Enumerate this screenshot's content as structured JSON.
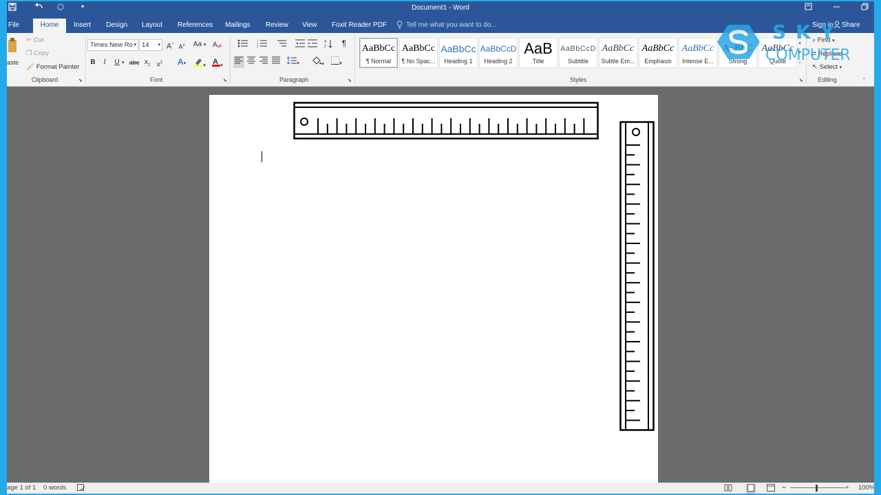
{
  "window": {
    "title": "Document1 - Word",
    "qat_icons": [
      "save-icon",
      "undo-icon",
      "redo-icon",
      "customize-icon"
    ],
    "controls": [
      "ribbon-display-icon",
      "minimize-icon",
      "restore-icon"
    ]
  },
  "tabs": [
    "File",
    "Home",
    "Insert",
    "Design",
    "Layout",
    "References",
    "Mailings",
    "Review",
    "View",
    "Foxit Reader PDF"
  ],
  "active_tab": "Home",
  "tell_me": "Tell me what you want to do...",
  "account": {
    "sign_in": "Sign in",
    "share": "Share"
  },
  "clipboard": {
    "paste": "aste",
    "cut": "Cut",
    "copy": "Copy",
    "format_painter": "Format Painter",
    "label": "Clipboard"
  },
  "font": {
    "name": "Times New Ro",
    "size": "14",
    "grow": "A",
    "shrink": "A",
    "case": "Aa",
    "bold": "B",
    "italic": "I",
    "underline": "U",
    "strike": "abc",
    "subscript": "x",
    "superscript": "x",
    "label": "Font",
    "highlight_color": "#ffff00",
    "font_color": "#e81123"
  },
  "paragraph": {
    "pilcrow": "¶",
    "label": "Paragraph"
  },
  "styles": {
    "label": "Styles",
    "items": [
      {
        "sample": "AaBbCc",
        "name": "¶ Normal"
      },
      {
        "sample": "AaBbCc",
        "name": "¶ No Spac..."
      },
      {
        "sample": "AaBbCc",
        "name": "Heading 1"
      },
      {
        "sample": "AaBbCcD",
        "name": "Heading 2"
      },
      {
        "sample": "AaB",
        "name": "Title"
      },
      {
        "sample": "AaBbCcD",
        "name": "Subtitle"
      },
      {
        "sample": "AaBbCc",
        "name": "Subtle Em..."
      },
      {
        "sample": "AaBbCc",
        "name": "Emphasis"
      },
      {
        "sample": "AaBbCc",
        "name": "Intense E..."
      },
      {
        "sample": "AaBbC",
        "name": "Strong"
      },
      {
        "sample": "AaBbCc",
        "name": "Quote"
      }
    ]
  },
  "editing": {
    "find": "Find",
    "replace": "Replace",
    "select": "Select",
    "label": "Editing"
  },
  "status": {
    "page": "age 1 of 1",
    "words": "0 words",
    "zoom": "100%"
  },
  "watermark": {
    "top": "SKY",
    "bottom": "COMPUTER",
    "color": "#2aa7e6"
  },
  "accent": "#2b579a"
}
